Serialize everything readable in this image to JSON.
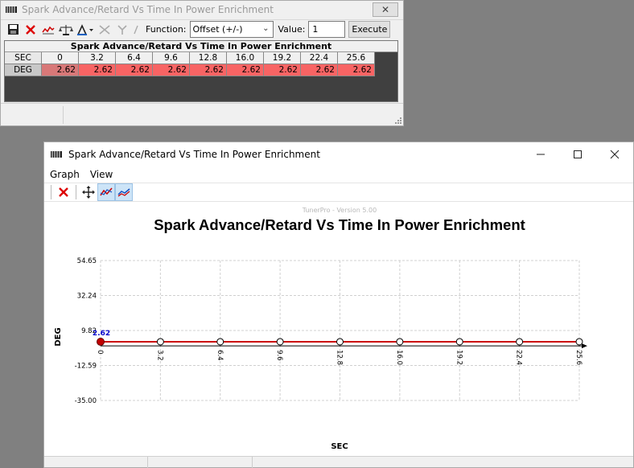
{
  "table_window": {
    "title": "Spark Advance/Retard Vs Time In Power Enrichment",
    "close_glyph": "✕",
    "toolbar": {
      "function_label": "Function:",
      "function_value": "Offset (+/-)",
      "value_label": "Value:",
      "value_input": "1",
      "execute_label": "Execute"
    },
    "grid": {
      "title": "Spark Advance/Retard Vs Time In Power Enrichment",
      "x_label": "SEC",
      "y_label": "DEG",
      "columns": [
        "0",
        "3.2",
        "6.4",
        "9.6",
        "12.8",
        "16.0",
        "19.2",
        "22.4",
        "25.6"
      ],
      "values": [
        "2.62",
        "2.62",
        "2.62",
        "2.62",
        "2.62",
        "2.62",
        "2.62",
        "2.62",
        "2.62"
      ]
    }
  },
  "graph_window": {
    "title": "Spark Advance/Retard Vs Time In Power Enrichment",
    "menu": [
      "Graph",
      "View"
    ],
    "colors": {
      "accent": "#cc0000",
      "series": "#cc0000",
      "marker_fill": "#ffffff",
      "label": "#0000cc"
    }
  },
  "chart_data": {
    "type": "line",
    "watermark": "TunerPro - Version 5.00",
    "title": "Spark Advance/Retard Vs Time In Power Enrichment",
    "xlabel": "SEC",
    "ylabel": "DEG",
    "x": [
      "0",
      "3.2",
      "6.4",
      "9.6",
      "12.8",
      "16.0",
      "19.2",
      "22.4",
      "25.6"
    ],
    "y_ticks": [
      "54.65",
      "32.24",
      "9.82",
      "-12.59",
      "-35.00"
    ],
    "ylim": [
      -35.0,
      54.65
    ],
    "series": [
      {
        "values": [
          2.62,
          2.62,
          2.62,
          2.62,
          2.62,
          2.62,
          2.62,
          2.62,
          2.62
        ]
      }
    ],
    "selected_point_label": "2.62",
    "grid": true
  }
}
